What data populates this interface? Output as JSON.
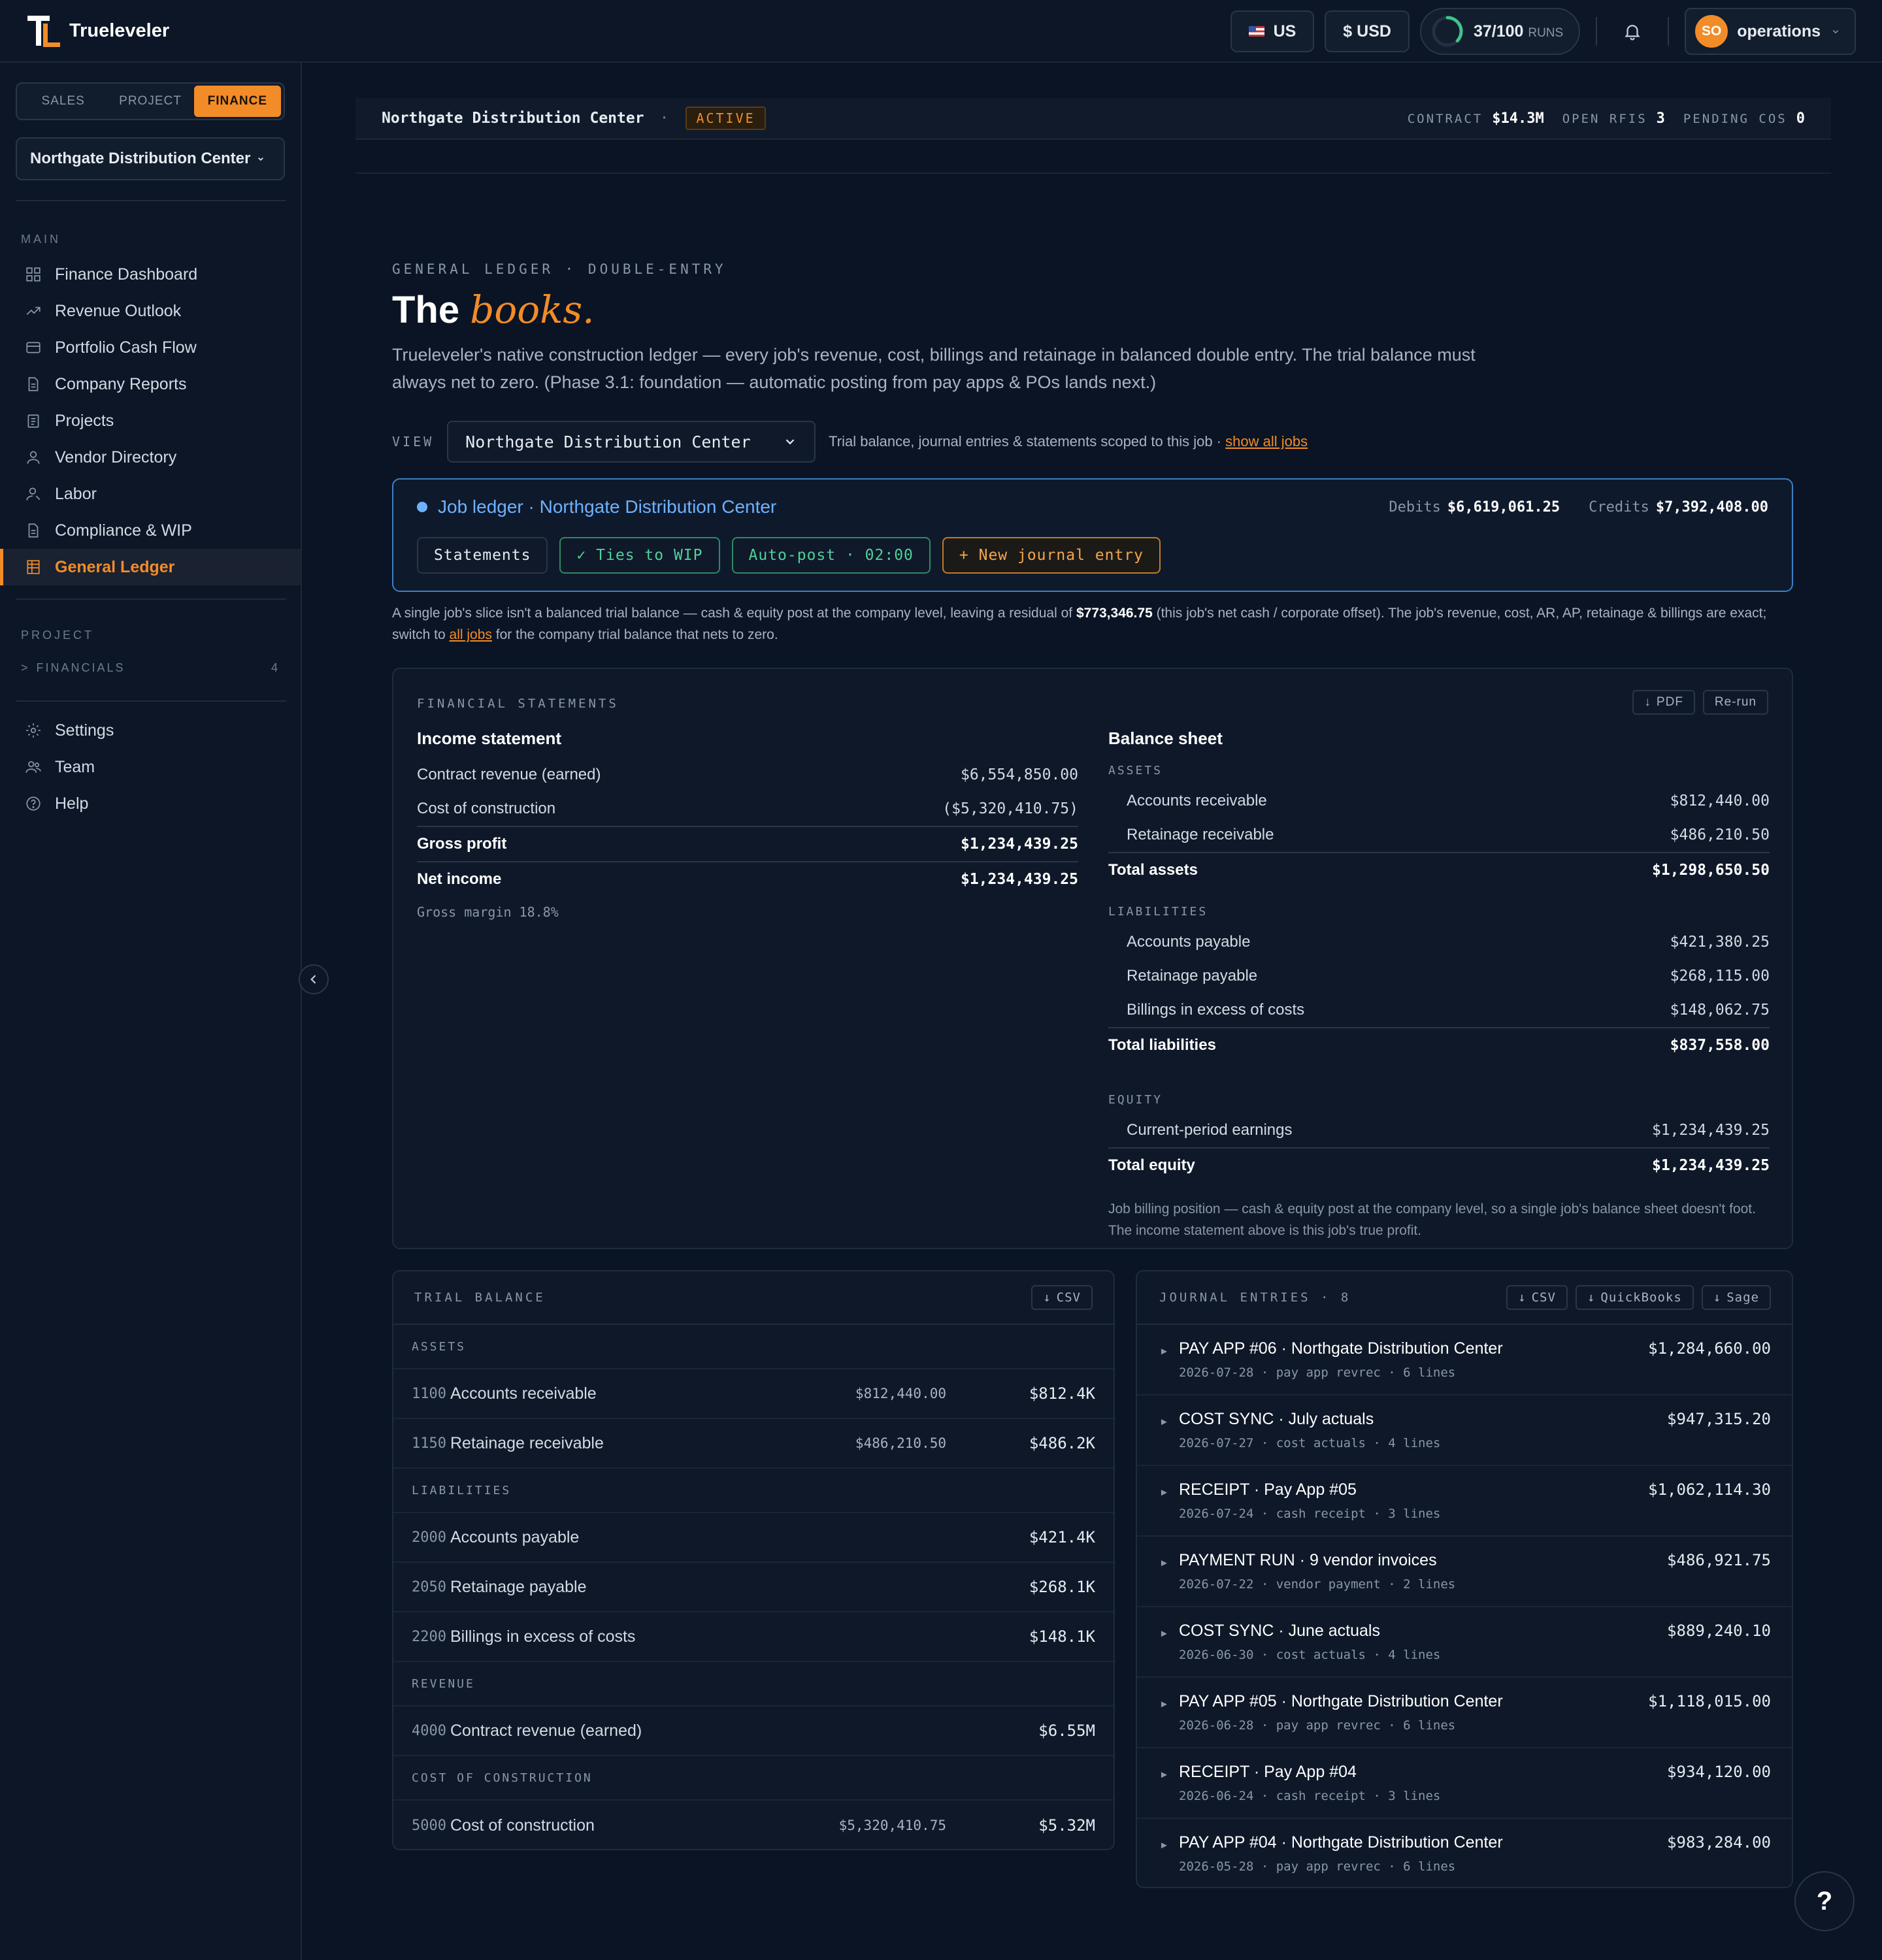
{
  "app": {
    "name": "Trueleveler"
  },
  "topbar": {
    "region": "US",
    "currency": "$ USD",
    "runs_count": "37/100",
    "runs_label": "RUNS",
    "runs_fraction": 0.37,
    "user_initials": "SO",
    "user_name": "operations"
  },
  "sidebar": {
    "modes": [
      "SALES",
      "PROJECT",
      "FINANCE"
    ],
    "active_mode": "FINANCE",
    "project": "Northgate Distribution Center",
    "main_label": "MAIN",
    "main_items": [
      {
        "label": "Finance Dashboard",
        "icon": "dashboard-icon"
      },
      {
        "label": "Revenue Outlook",
        "icon": "trend-icon"
      },
      {
        "label": "Portfolio Cash Flow",
        "icon": "card-icon"
      },
      {
        "label": "Company Reports",
        "icon": "document-icon"
      },
      {
        "label": "Projects",
        "icon": "clipboard-icon"
      },
      {
        "label": "Vendor Directory",
        "icon": "person-icon"
      },
      {
        "label": "Labor",
        "icon": "worker-icon"
      },
      {
        "label": "Compliance & WIP",
        "icon": "document-icon"
      },
      {
        "label": "General Ledger",
        "icon": "ledger-icon",
        "active": true
      }
    ],
    "project_label": "PROJECT",
    "financials_label": "FINANCIALS",
    "financials_count": "4",
    "footer_items": [
      {
        "label": "Settings",
        "icon": "gear-icon"
      },
      {
        "label": "Team",
        "icon": "team-icon"
      },
      {
        "label": "Help",
        "icon": "help-circle-icon"
      }
    ]
  },
  "strip": {
    "project": "Northgate Distribution Center",
    "sep": "·",
    "status": "ACTIVE",
    "contract_label": "CONTRACT",
    "contract": "$14.3M",
    "rfis_label": "OPEN RFIS",
    "rfis": "3",
    "cos_label": "PENDING COS",
    "cos": "0"
  },
  "page": {
    "eyebrow": "GENERAL LEDGER · DOUBLE-ENTRY",
    "title_plain": "The",
    "title_accent": "books.",
    "description": "Trueleveler's native construction ledger — every job's revenue, cost, billings and retainage in balanced double entry. The trial balance must always net to zero. (Phase 3.1: foundation — automatic posting from pay apps & POs lands next.)",
    "view_label": "VIEW",
    "view_value": "Northgate Distribution Center",
    "view_note": "Trial balance, journal entries & statements scoped to this job ·",
    "view_link": "show all jobs"
  },
  "job": {
    "title": "Job ledger · Northgate Distribution Center",
    "debits_label": "Debits",
    "debits": "$6,619,061.25",
    "credits_label": "Credits",
    "credits": "$7,392,408.00",
    "btn_statements": "Statements",
    "btn_wip": "✓ Ties to WIP",
    "btn_autopost": "Auto-post · 02:00",
    "btn_new": "+ New journal entry"
  },
  "residual": {
    "pre": "A single job's slice isn't a balanced trial balance — cash & equity post at the company level, leaving a residual of",
    "amount": "$773,346.75",
    "mid": "(this job's net cash / corporate offset). The job's revenue, cost, AR, AP, retainage & billings are exact; switch to",
    "link": "all jobs",
    "post": "for the company trial balance that nets to zero."
  },
  "statements": {
    "label": "FINANCIAL STATEMENTS",
    "pdf": "PDF",
    "rerun": "Re-run",
    "income": {
      "title": "Income statement",
      "revenue_label": "Contract revenue (earned)",
      "revenue": "$6,554,850.00",
      "cost_label": "Cost of construction",
      "cost": "($5,320,410.75)",
      "gross_label": "Gross profit",
      "gross": "$1,234,439.25",
      "net_label": "Net income",
      "net": "$1,234,439.25",
      "margin": "Gross margin 18.8%"
    },
    "balance": {
      "title": "Balance sheet",
      "assets_label": "ASSETS",
      "ar_label": "Accounts receivable",
      "ar": "$812,440.00",
      "rr_label": "Retainage receivable",
      "rr": "$486,210.50",
      "ta_label": "Total assets",
      "ta": "$1,298,650.50",
      "liab_label": "LIABILITIES",
      "ap_label": "Accounts payable",
      "ap": "$421,380.25",
      "rp_label": "Retainage payable",
      "rp": "$268,115.00",
      "bx_label": "Billings in excess of costs",
      "bx": "$148,062.75",
      "tl_label": "Total liabilities",
      "tl": "$837,558.00",
      "eq_label": "EQUITY",
      "cpe_label": "Current-period earnings",
      "cpe": "$1,234,439.25",
      "te_label": "Total equity",
      "te": "$1,234,439.25",
      "note": "Job billing position — cash & equity post at the company level, so a single job's balance sheet doesn't foot. The income statement above is this job's true profit."
    }
  },
  "trial": {
    "label": "TRIAL BALANCE",
    "csv": "CSV",
    "groups": [
      {
        "name": "ASSETS",
        "rows": [
          {
            "code": "1100",
            "name": "Accounts receivable",
            "exact": "$812,440.00",
            "short": "$812.4K"
          },
          {
            "code": "1150",
            "name": "Retainage receivable",
            "exact": "$486,210.50",
            "short": "$486.2K"
          }
        ]
      },
      {
        "name": "LIABILITIES",
        "rows": [
          {
            "code": "2000",
            "name": "Accounts payable",
            "exact": "",
            "short": "$421.4K"
          },
          {
            "code": "2050",
            "name": "Retainage payable",
            "exact": "",
            "short": "$268.1K"
          },
          {
            "code": "2200",
            "name": "Billings in excess of costs",
            "exact": "",
            "short": "$148.1K"
          }
        ]
      },
      {
        "name": "REVENUE",
        "rows": [
          {
            "code": "4000",
            "name": "Contract revenue (earned)",
            "exact": "",
            "short": "$6.55M"
          }
        ]
      },
      {
        "name": "COST OF CONSTRUCTION",
        "rows": [
          {
            "code": "5000",
            "name": "Cost of construction",
            "exact": "$5,320,410.75",
            "short": "$5.32M"
          }
        ]
      }
    ]
  },
  "journal": {
    "label": "JOURNAL ENTRIES · 8",
    "csv": "CSV",
    "qb": "QuickBooks",
    "sage": "Sage",
    "entries": [
      {
        "title": "PAY APP #06 · Northgate Distribution Center",
        "meta": "2026-07-28 · pay app revrec · 6 lines",
        "amount": "$1,284,660.00"
      },
      {
        "title": "COST SYNC · July actuals",
        "meta": "2026-07-27 · cost actuals · 4 lines",
        "amount": "$947,315.20"
      },
      {
        "title": "RECEIPT · Pay App #05",
        "meta": "2026-07-24 · cash receipt · 3 lines",
        "amount": "$1,062,114.30"
      },
      {
        "title": "PAYMENT RUN · 9 vendor invoices",
        "meta": "2026-07-22 · vendor payment · 2 lines",
        "amount": "$486,921.75"
      },
      {
        "title": "COST SYNC · June actuals",
        "meta": "2026-06-30 · cost actuals · 4 lines",
        "amount": "$889,240.10"
      },
      {
        "title": "PAY APP #05 · Northgate Distribution Center",
        "meta": "2026-06-28 · pay app revrec · 6 lines",
        "amount": "$1,118,015.00"
      },
      {
        "title": "RECEIPT · Pay App #04",
        "meta": "2026-06-24 · cash receipt · 3 lines",
        "amount": "$934,120.00"
      },
      {
        "title": "PAY APP #04 · Northgate Distribution Center",
        "meta": "2026-05-28 · pay app revrec · 6 lines",
        "amount": "$983,284.00"
      }
    ]
  },
  "help": {
    "label": "?"
  },
  "colors": {
    "accent": "#f28c28",
    "link_blue": "#6fb1ff",
    "success": "#4fd19a",
    "bg": "#0b1424"
  }
}
